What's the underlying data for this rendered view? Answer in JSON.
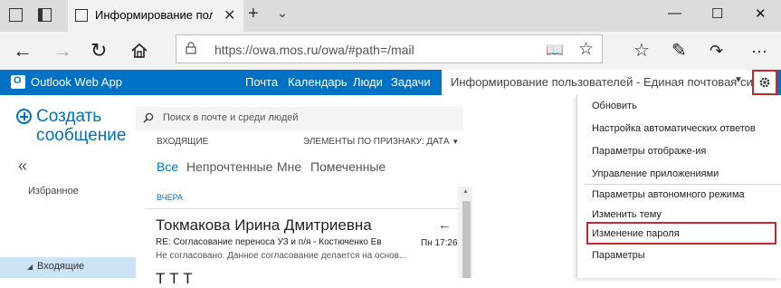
{
  "browser": {
    "tab_title": "Информирование пол",
    "new_tab": "+",
    "tab_list": "⌄",
    "url_host": "https://owa.mos.ru",
    "url_path": "/owa/#path=/mail",
    "win_min": "—",
    "win_max": "☐",
    "win_close": "✕"
  },
  "owa": {
    "app_title": "Outlook Web App",
    "logo_letter": "O",
    "nav": [
      "Почта",
      "Календарь",
      "Люди",
      "Задачи"
    ],
    "user_text": "Информирование пользователей - Единая почтовая сис...",
    "create_line1": "Создать",
    "create_line2": "сообщение",
    "collapse": "«",
    "favorites": "Избранное",
    "inbox": "Входящие",
    "search_placeholder": "Поиск в почте и среди людей",
    "folder_label": "ВХОДЯЩИЕ",
    "sort_label": "ЭЛЕМЕНТЫ ПО ПРИЗНАКУ: ДАТА",
    "filters": [
      "Все",
      "Непрочтенные",
      "Мне",
      "Помеченные"
    ],
    "date_group": "ВЧЕРА",
    "message": {
      "from": "Токмакова Ирина Дмитриевна",
      "subject": "RE: Согласование переноса УЗ и п/я - Костюченко Ев",
      "time": "Пн 17:26",
      "preview": "Не согласовано. Данное согласование делается на основ..."
    },
    "next_from": "Т          Т     Т"
  },
  "menu": {
    "group1": [
      "Обновить",
      "Настройка автоматических ответов",
      "Параметры отображе-ия",
      "Управление приложениями"
    ],
    "group2": [
      "Параметры автономного режима",
      "Изменить тему",
      "Изменение пароля",
      "Параметры"
    ],
    "highlighted": "Изменение пароля"
  },
  "colors": {
    "brand": "#0072c6",
    "highlight_border": "#c8282a"
  }
}
